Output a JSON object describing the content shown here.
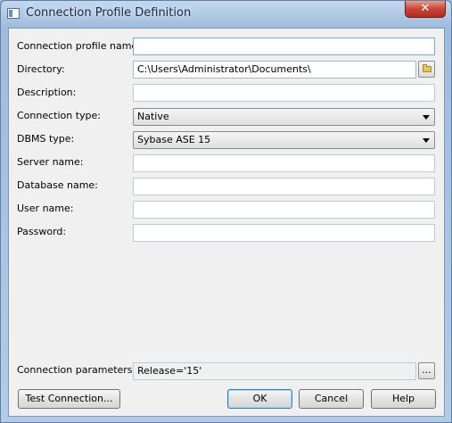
{
  "window": {
    "title": "Connection Profile Definition",
    "close_glyph": "✕"
  },
  "labels": {
    "profile_name": "Connection profile name:",
    "directory": "Directory:",
    "description": "Description:",
    "connection_type": "Connection type:",
    "dbms_type": "DBMS type:",
    "server_name": "Server name:",
    "database_name": "Database name:",
    "user_name": "User name:",
    "password": "Password:",
    "connection_parameters": "Connection parameters:"
  },
  "values": {
    "profile_name": "",
    "directory": "C:\\Users\\Administrator\\Documents\\",
    "description": "",
    "connection_type": "Native",
    "dbms_type": "Sybase ASE 15",
    "server_name": "",
    "database_name": "",
    "user_name": "",
    "password": "",
    "connection_parameters": "Release='15'"
  },
  "buttons": {
    "browse_params": "...",
    "test_connection": "Test Connection...",
    "ok": "OK",
    "cancel": "Cancel",
    "help": "Help"
  },
  "icons": {
    "app": "window-icon",
    "folder": "folder-icon",
    "dropdown": "chevron-down-icon"
  }
}
